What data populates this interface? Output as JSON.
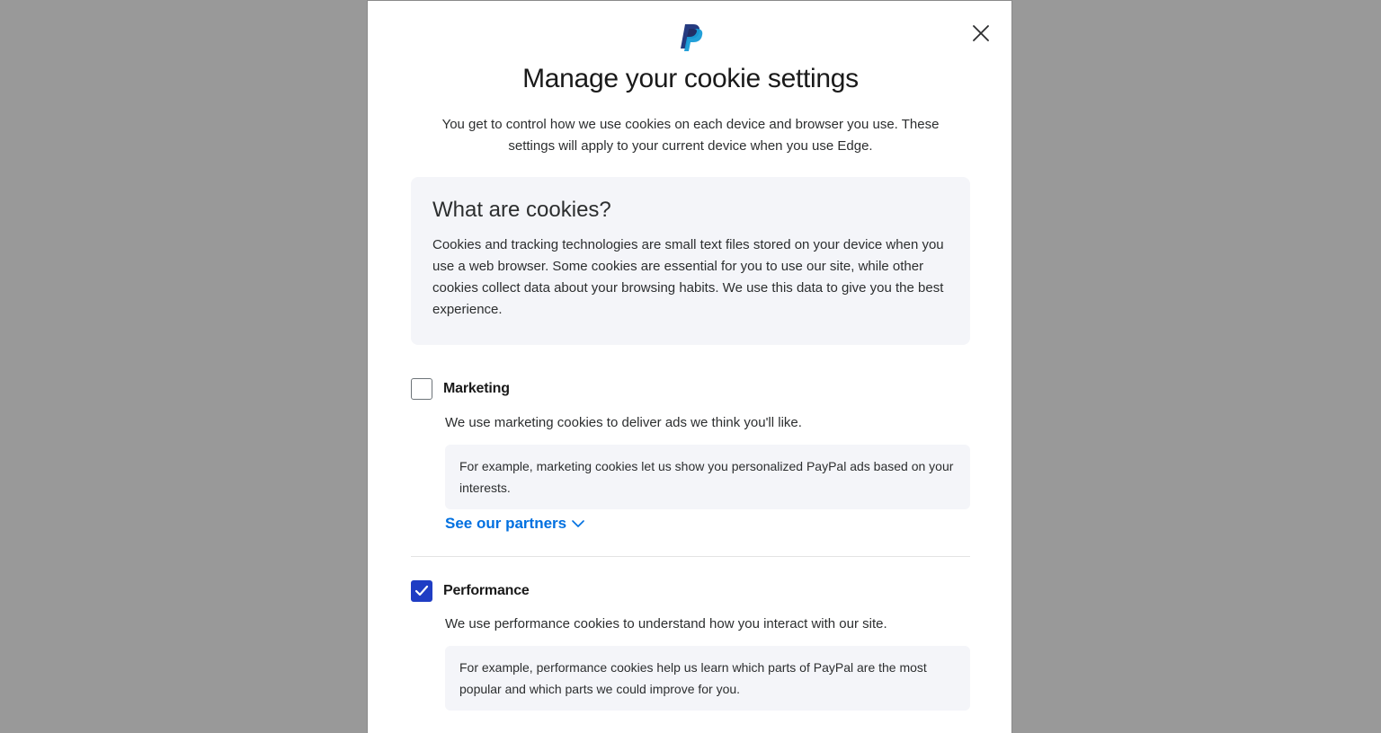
{
  "modal": {
    "title": "Manage your cookie settings",
    "intro": "You get to control how we use cookies on each device and browser you use. These settings will apply to your current device when you use Edge.",
    "close_icon": "close-icon",
    "logo_icon": "paypal-logo"
  },
  "info": {
    "heading": "What are cookies?",
    "body": "Cookies and tracking technologies are small text files stored on your device when you use a web browser. Some cookies are essential for you to use our site, while other cookies collect data about your browsing habits. We use this data to give you the best experience."
  },
  "categories": [
    {
      "label": "Marketing",
      "checked": false,
      "description": "We use marketing cookies to deliver ads we think you'll like.",
      "example": "For example, marketing cookies let us show you personalized PayPal ads based on your interests.",
      "link": "See our partners"
    },
    {
      "label": "Performance",
      "checked": true,
      "description": "We use performance cookies to understand how you interact with our site.",
      "example": "For example, performance cookies help us learn which parts of PayPal are the most popular and which parts we could improve for you."
    }
  ],
  "colors": {
    "backdrop": "#999999",
    "accent": "#1f3dc4",
    "link": "#0070e0",
    "panel": "#f4f5f9"
  }
}
